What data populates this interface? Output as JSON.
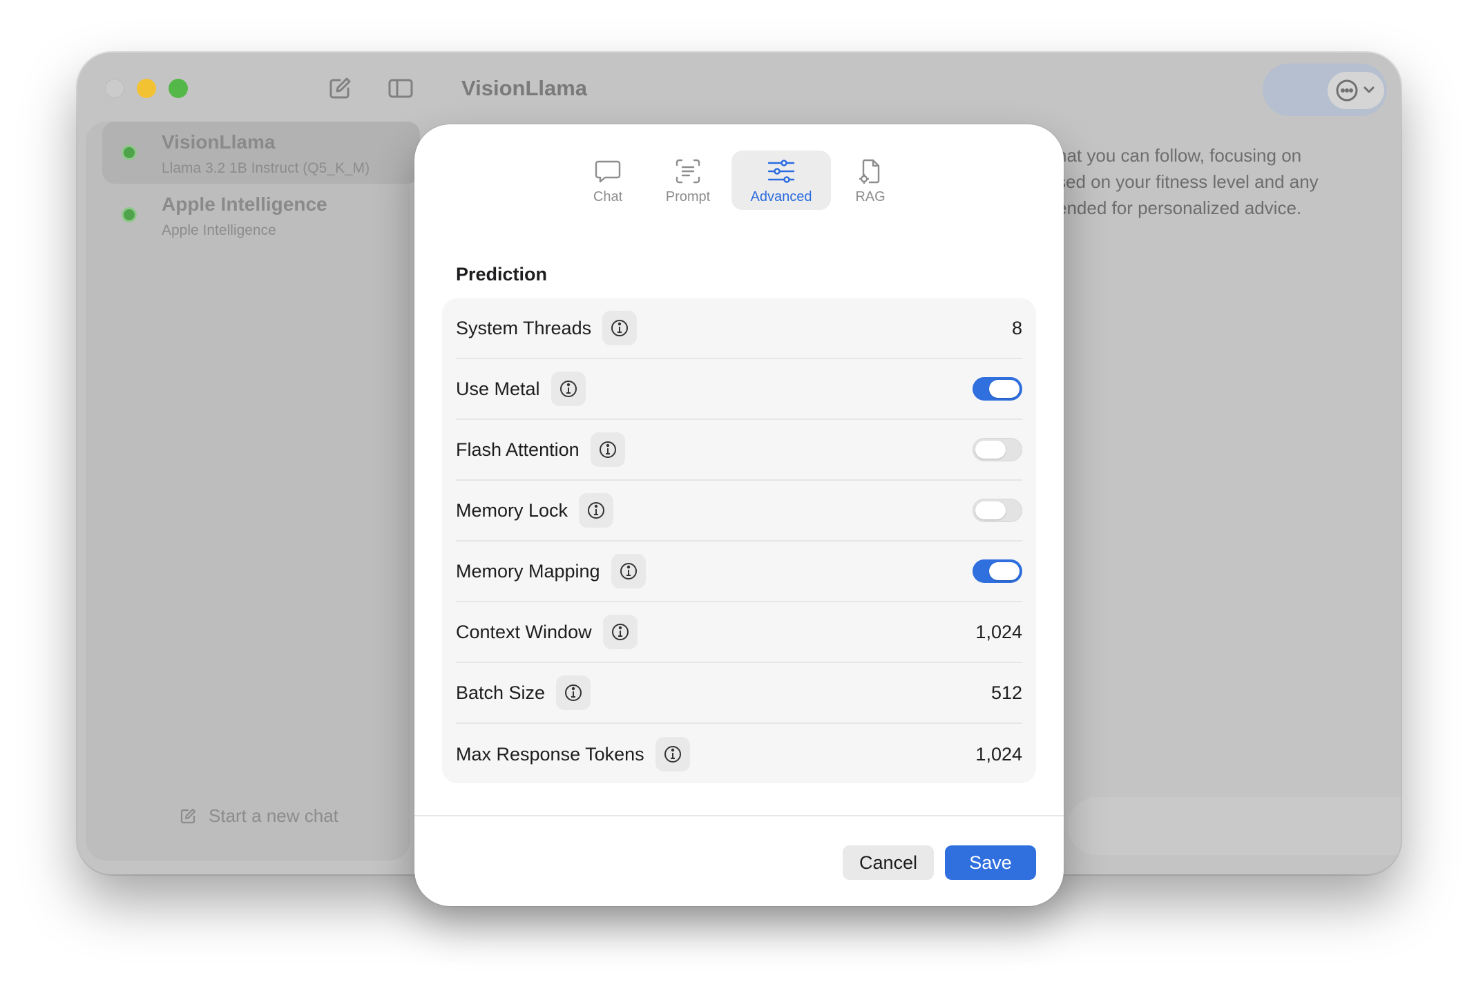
{
  "window": {
    "title": "VisionLlama"
  },
  "sidebar": {
    "items": [
      {
        "name": "VisionLlama",
        "subtitle": "Llama 3.2 1B Instruct (Q5_K_M)"
      },
      {
        "name": "Apple Intelligence",
        "subtitle": "Apple Intelligence"
      }
    ],
    "new_chat_label": "Start a new chat"
  },
  "chat": {
    "lines": [
      "hat you can follow, focusing on",
      "sed on your fitness level and any",
      "ended for personalized advice."
    ]
  },
  "modal": {
    "tabs": [
      {
        "label": "Chat",
        "icon": "chat-bubble-icon"
      },
      {
        "label": "Prompt",
        "icon": "prompt-icon"
      },
      {
        "label": "Advanced",
        "icon": "sliders-icon"
      },
      {
        "label": "RAG",
        "icon": "document-gear-icon"
      }
    ],
    "active_tab": "Advanced",
    "section_title": "Prediction",
    "rows": [
      {
        "label": "System Threads",
        "type": "value",
        "value": "8"
      },
      {
        "label": "Use Metal",
        "type": "toggle",
        "on": true
      },
      {
        "label": "Flash Attention",
        "type": "toggle",
        "on": false
      },
      {
        "label": "Memory Lock",
        "type": "toggle",
        "on": false
      },
      {
        "label": "Memory Mapping",
        "type": "toggle",
        "on": true
      },
      {
        "label": "Context Window",
        "type": "value",
        "value": "1,024"
      },
      {
        "label": "Batch Size",
        "type": "value",
        "value": "512"
      },
      {
        "label": "Max Response Tokens",
        "type": "value",
        "value": "1,024"
      }
    ],
    "cancel_label": "Cancel",
    "save_label": "Save"
  },
  "colors": {
    "accent": "#2f6fde",
    "traffic_min": "#f3c233",
    "traffic_max": "#54b848",
    "status_dot": "#4fa34a"
  }
}
